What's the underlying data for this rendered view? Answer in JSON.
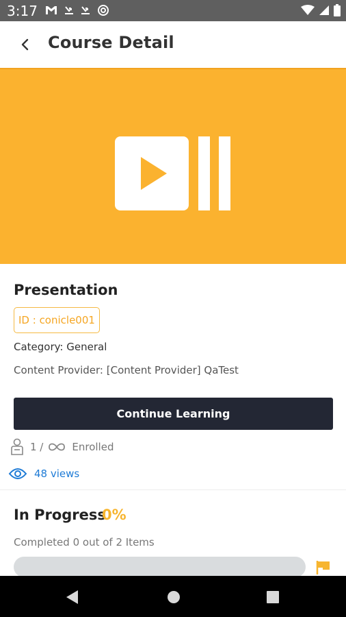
{
  "status_bar": {
    "time": "3:17",
    "icons": [
      "gmail-icon",
      "missed-call-icon",
      "missed-call-icon",
      "at-sign-icon",
      "wifi-icon",
      "signal-icon",
      "battery-icon"
    ]
  },
  "app_bar": {
    "title": "Course Detail"
  },
  "banner": {
    "background": "#FBB22F",
    "icon": "presentation-play-icon"
  },
  "course": {
    "title": "Presentation",
    "id_label": "ID : conicle001",
    "category": "Category: General",
    "provider": "Content Provider: [Content Provider] QaTest",
    "continue_label": "Continue Learning",
    "enrolled_count": "1 /",
    "enrolled_label": "Enrolled",
    "views": "48 views"
  },
  "progress": {
    "heading": "In Progress",
    "percent_label": "0%",
    "percent": 0,
    "completed_text": "Completed 0 out of 2 Items"
  },
  "colors": {
    "accent": "#F7B52F",
    "button_dark": "#232734",
    "link_blue": "#1E7BD6"
  }
}
